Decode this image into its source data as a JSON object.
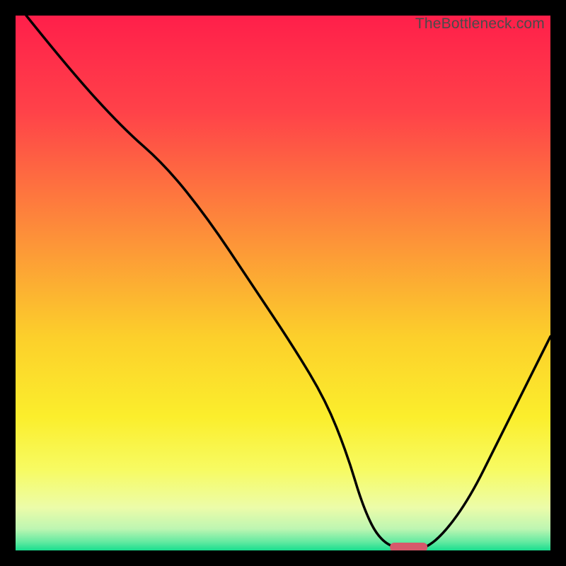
{
  "watermark": "TheBottleneck.com",
  "chart_data": {
    "type": "line",
    "title": "",
    "xlabel": "",
    "ylabel": "",
    "xlim": [
      0,
      100
    ],
    "ylim": [
      0,
      100
    ],
    "grid": false,
    "legend": false,
    "series": [
      {
        "name": "bottleneck-curve",
        "x": [
          2,
          10,
          20,
          28,
          36,
          44,
          52,
          58,
          62,
          65,
          68,
          72,
          76,
          80,
          85,
          90,
          95,
          100
        ],
        "values": [
          100,
          90,
          79,
          72,
          62,
          50,
          38,
          28,
          18,
          8,
          2,
          0,
          0,
          3,
          10,
          20,
          30,
          40
        ]
      }
    ],
    "annotations": [
      {
        "name": "optimal-marker",
        "x_range": [
          70,
          77
        ],
        "y": 0,
        "color": "#d6596b"
      }
    ],
    "background_gradient": {
      "stops": [
        {
          "offset": 0.0,
          "color": "#ff1f4a"
        },
        {
          "offset": 0.18,
          "color": "#ff4249"
        },
        {
          "offset": 0.4,
          "color": "#fd8c3a"
        },
        {
          "offset": 0.6,
          "color": "#fccf2b"
        },
        {
          "offset": 0.75,
          "color": "#fbee2c"
        },
        {
          "offset": 0.85,
          "color": "#f7fb63"
        },
        {
          "offset": 0.92,
          "color": "#ecfca9"
        },
        {
          "offset": 0.96,
          "color": "#bdf6b2"
        },
        {
          "offset": 0.985,
          "color": "#5fe9a0"
        },
        {
          "offset": 1.0,
          "color": "#19de8f"
        }
      ]
    }
  }
}
